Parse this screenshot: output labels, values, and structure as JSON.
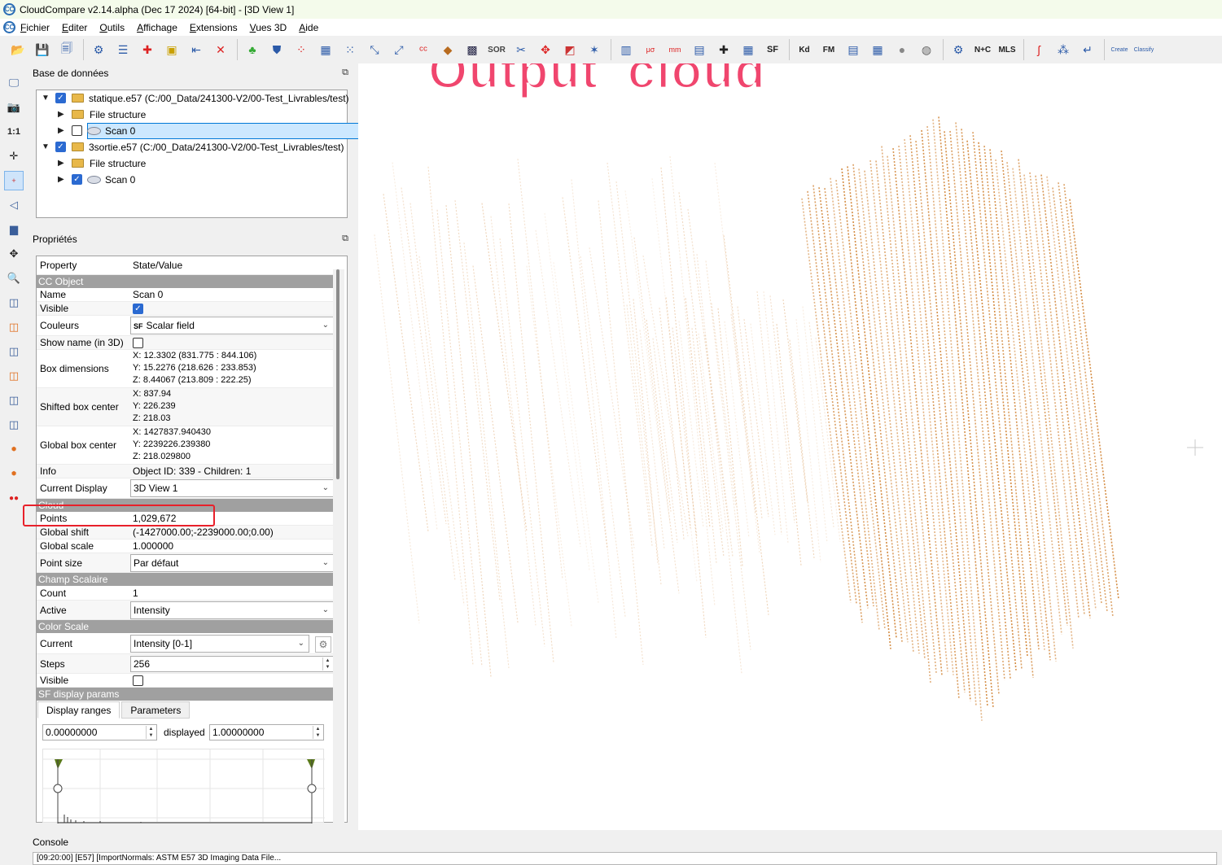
{
  "window": {
    "title": "CloudCompare v2.14.alpha (Dec 17 2024) [64-bit] - [3D View 1]",
    "logo_text": "CC"
  },
  "menu": [
    "Fichier",
    "Editer",
    "Outils",
    "Affichage",
    "Extensions",
    "Vues 3D",
    "Aide"
  ],
  "toolbar": {
    "kd_label": "Kd",
    "fm_label": "FM",
    "ntc_label": "N+C",
    "mls_label": "MLS",
    "sf_label": "SF",
    "sor_label": "SOR",
    "canupo_create": "Create",
    "canupo_classify": "Classify"
  },
  "db_panel": {
    "title": "Base de données",
    "tree": [
      {
        "label": "statique.e57 (C:/00_Data/241300-V2/00-Test_Livrables/test)",
        "checked": true
      },
      {
        "label": "File structure"
      },
      {
        "label": "Scan 0",
        "checked": false,
        "selected": true
      },
      {
        "label": "3sortie.e57 (C:/00_Data/241300-V2/00-Test_Livrables/test)",
        "checked": true
      },
      {
        "label": "File structure"
      },
      {
        "label": "Scan 0",
        "checked": true
      }
    ]
  },
  "props_panel": {
    "title": "Propriétés",
    "col_property": "Property",
    "col_value": "State/Value",
    "sections": {
      "cc_object": "CC Object",
      "cloud": "Cloud",
      "scalar": "Champ Scalaire",
      "color_scale": "Color Scale",
      "sf_display": "SF display params"
    },
    "name": {
      "k": "Name",
      "v": "Scan 0"
    },
    "visible": {
      "k": "Visible"
    },
    "colors": {
      "k": "Couleurs",
      "v": "Scalar field",
      "icon_text": "SF"
    },
    "show_name": {
      "k": "Show name (in 3D)"
    },
    "box_dims": {
      "k": "Box dimensions",
      "x": "X: 12.3302 (831.775 : 844.106)",
      "y": "Y: 15.2276 (218.626 : 233.853)",
      "z": "Z: 8.44067 (213.809 : 222.25)"
    },
    "shifted_center": {
      "k": "Shifted box center",
      "x": "X: 837.94",
      "y": "Y: 226.239",
      "z": "Z: 218.03"
    },
    "global_center": {
      "k": "Global box center",
      "x": "X: 1427837.940430",
      "y": "Y: 2239226.239380",
      "z": "Z: 218.029800"
    },
    "info": {
      "k": "Info",
      "v": "Object ID: 339 - Children: 1"
    },
    "current_display": {
      "k": "Current Display",
      "v": "3D View 1"
    },
    "points": {
      "k": "Points",
      "v": "1,029,672"
    },
    "global_shift": {
      "k": "Global shift",
      "v": "(-1427000.00;-2239000.00;0.00)"
    },
    "global_scale": {
      "k": "Global scale",
      "v": "1.000000"
    },
    "point_size": {
      "k": "Point size",
      "v": "Par défaut"
    },
    "count": {
      "k": "Count",
      "v": "1"
    },
    "active": {
      "k": "Active",
      "v": "Intensity"
    },
    "current": {
      "k": "Current",
      "v": "Intensity [0-1]"
    },
    "steps": {
      "k": "Steps",
      "v": "256"
    },
    "cs_visible": {
      "k": "Visible"
    },
    "tabs": [
      "Display ranges",
      "Parameters"
    ],
    "range_min": "0.00000000",
    "displayed_label": "displayed",
    "range_max": "1.00000000"
  },
  "view3d": {
    "overlay_text": "Output_cloud"
  },
  "console": {
    "title": "Console",
    "line": "[09:20:00] [E57] [ImportNormals: ASTM E57 3D Imaging Data File..."
  },
  "colors": {
    "overlay_text": "#f0466e",
    "selection": "#cce8ff",
    "section_header": "#a0a0a0",
    "highlight": "#e8202a",
    "cloud_scanlines": "#d18436"
  }
}
